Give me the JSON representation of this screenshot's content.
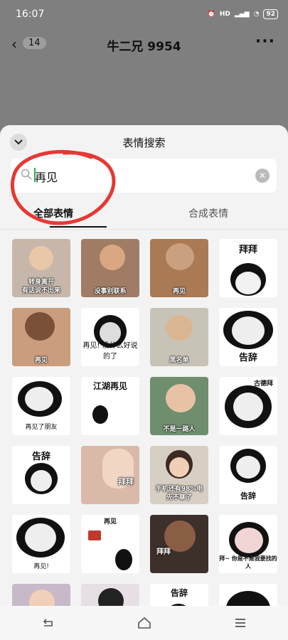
{
  "status": {
    "time": "16:07",
    "battery": "92"
  },
  "chat": {
    "back_count": "14",
    "title": "牛二兄 9954"
  },
  "sheet": {
    "title": "表情搜索",
    "search": {
      "value": "再见"
    },
    "tabs": [
      {
        "label": "全部表情"
      },
      {
        "label": "合成表情"
      }
    ]
  },
  "stickers": [
    {
      "caption": "转身离开\n有话说不出来"
    },
    {
      "caption": "没事别联系"
    },
    {
      "caption": "再见"
    },
    {
      "caption": "拜拜"
    },
    {
      "caption": "再见"
    },
    {
      "caption": "再见! 没什么好说的了"
    },
    {
      "caption": "黑名单"
    },
    {
      "caption": "告辞"
    },
    {
      "caption": "再见了朋友"
    },
    {
      "caption": "江湖再见"
    },
    {
      "caption": "不是一路人"
    },
    {
      "caption": "古德拜"
    },
    {
      "caption": "告辞"
    },
    {
      "caption": "拜拜"
    },
    {
      "caption": "手机还有98%电\n先不聊了"
    },
    {
      "caption": "告辞"
    },
    {
      "caption": "再见!"
    },
    {
      "caption": "再见"
    },
    {
      "caption": "拜拜"
    },
    {
      "caption": "拜~ 你是不是我要找的人"
    },
    {
      "caption": ""
    },
    {
      "caption": ""
    },
    {
      "caption": "告辞"
    },
    {
      "caption": ""
    }
  ],
  "icons": {
    "nav_back": "back-triangle-icon",
    "nav_home": "home-icon",
    "nav_menu": "menu-icon"
  },
  "colors": {
    "accent": "#2ab350",
    "annotation": "#e53935"
  }
}
